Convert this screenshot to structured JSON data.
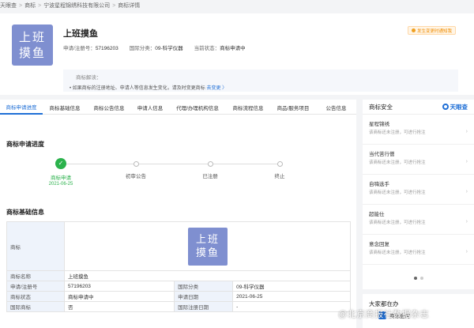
{
  "breadcrumb": [
    "天眼查",
    "商标",
    "宁波星程锦绣科技有限公司",
    "商标详情"
  ],
  "header": {
    "logo_line1": "上班",
    "logo_line2": "摸鱼",
    "title": "上班摸鱼",
    "reg_label": "申请/注册号：",
    "reg_value": "57196203",
    "class_label": "国际分类：",
    "class_value": "09-科学仪器",
    "status_label": "当前状态：",
    "status_value": "商标申请中",
    "warning_badge": "发生变更时通知我",
    "interpret_title": "商标解读：",
    "interpret_text": "• 如果商标的注册地址、申请人等信息发生变化，请及时变更商标",
    "interpret_link": "去变更 〉"
  },
  "tabs": [
    "商标申请进度",
    "商标基础信息",
    "商标公告信息",
    "申请人信息",
    "代理/办理机构信息",
    "商标流程信息",
    "商品/服务项目",
    "公告信息"
  ],
  "progress": {
    "title": "商标申请进度",
    "steps": [
      {
        "label": "商标申请",
        "date": "2021-06-25"
      },
      {
        "label": "初审公告",
        "date": ""
      },
      {
        "label": "已注册",
        "date": ""
      },
      {
        "label": "终止",
        "date": ""
      }
    ]
  },
  "basic": {
    "title": "商标基础信息",
    "logo_label": "商标",
    "name_label": "商标名称",
    "name_value": "上班摸鱼",
    "reg_label": "申请/注册号",
    "reg_value": "57196203",
    "class_label": "国际分类",
    "class_value": "09-科学仪器",
    "status_label": "商标状态",
    "status_value": "商标申请中",
    "apply_date_label": "申请日期",
    "apply_date_value": "2021-06-25",
    "intl_label": "国际商标",
    "intl_value": "否",
    "intl_reg_date_label": "国际注册日期",
    "intl_reg_date_value": "-"
  },
  "sidebar": {
    "title": "商标安全",
    "brand": "天眼查",
    "items": [
      {
        "name": "星程锦绣",
        "desc": "该商标还未注册，可进行抢注"
      },
      {
        "name": "当代苦行僧",
        "desc": "该商标还未注册，可进行抢注"
      },
      {
        "name": "自嗨选手",
        "desc": "该商标还未注册，可进行抢注"
      },
      {
        "name": "超能仕",
        "desc": "该商标还未注册，可进行抢注"
      },
      {
        "name": "意念回复",
        "desc": "该商标还未注册，可进行抢注"
      }
    ],
    "more_title": "大家都在办",
    "more_item": "商标查询"
  },
  "watermark": "@北京商报社数据杂志"
}
